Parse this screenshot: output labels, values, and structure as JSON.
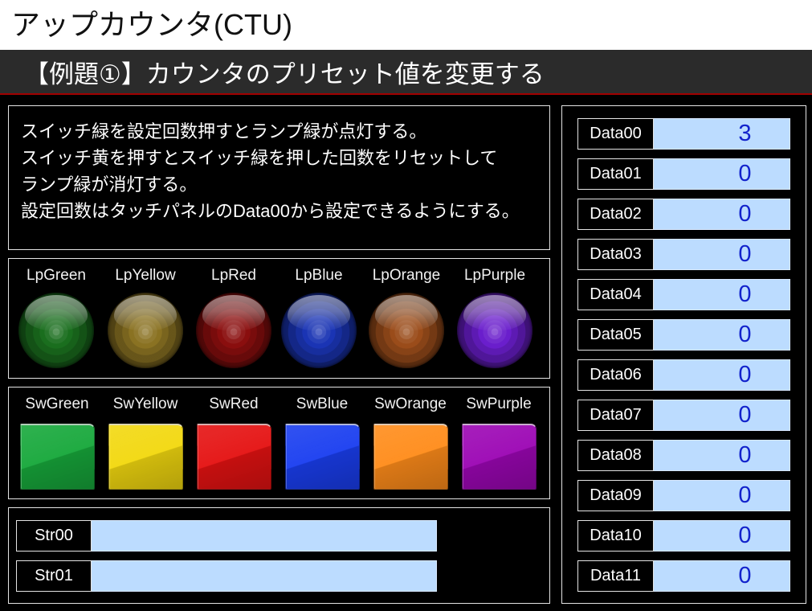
{
  "header": {
    "title": "アップカウンタ(CTU)",
    "subtitle": "【例題①】カウンタのプリセット値を変更する"
  },
  "description": {
    "lines": [
      "スイッチ緑を設定回数押すとランプ緑が点灯する。",
      "スイッチ黄を押すとスイッチ緑を押した回数をリセットして",
      "ランプ緑が消灯する。",
      "設定回数はタッチパネルのData00から設定できるようにする。"
    ]
  },
  "lamps": [
    {
      "label": "LpGreen",
      "color": "#1a6e1e"
    },
    {
      "label": "LpYellow",
      "color": "#8a7222"
    },
    {
      "label": "LpRed",
      "color": "#8a0e0e"
    },
    {
      "label": "LpBlue",
      "color": "#1a34b4"
    },
    {
      "label": "LpOrange",
      "color": "#9a4c1a"
    },
    {
      "label": "LpPurple",
      "color": "#6a1ecc"
    }
  ],
  "switches": [
    {
      "label": "SwGreen",
      "color": "#17a83b"
    },
    {
      "label": "SwYellow",
      "color": "#f2d80f"
    },
    {
      "label": "SwRed",
      "color": "#e51212"
    },
    {
      "label": "SwBlue",
      "color": "#1a3ef0"
    },
    {
      "label": "SwOrange",
      "color": "#ff8c1a"
    },
    {
      "label": "SwPurple",
      "color": "#9c06b4"
    }
  ],
  "strings": [
    {
      "label": "Str00",
      "value": ""
    },
    {
      "label": "Str01",
      "value": ""
    }
  ],
  "data_registers": [
    {
      "label": "Data00",
      "value": 3
    },
    {
      "label": "Data01",
      "value": 0
    },
    {
      "label": "Data02",
      "value": 0
    },
    {
      "label": "Data03",
      "value": 0
    },
    {
      "label": "Data04",
      "value": 0
    },
    {
      "label": "Data05",
      "value": 0
    },
    {
      "label": "Data06",
      "value": 0
    },
    {
      "label": "Data07",
      "value": 0
    },
    {
      "label": "Data08",
      "value": 0
    },
    {
      "label": "Data09",
      "value": 0
    },
    {
      "label": "Data10",
      "value": 0
    },
    {
      "label": "Data11",
      "value": 0
    }
  ],
  "colors": {
    "field_background": "#bcdcff",
    "field_text": "#1222cc",
    "accent_line": "#a00000",
    "title_bar_background": "#ffffff",
    "subtitle_bar_background": "#2b2b2b"
  }
}
